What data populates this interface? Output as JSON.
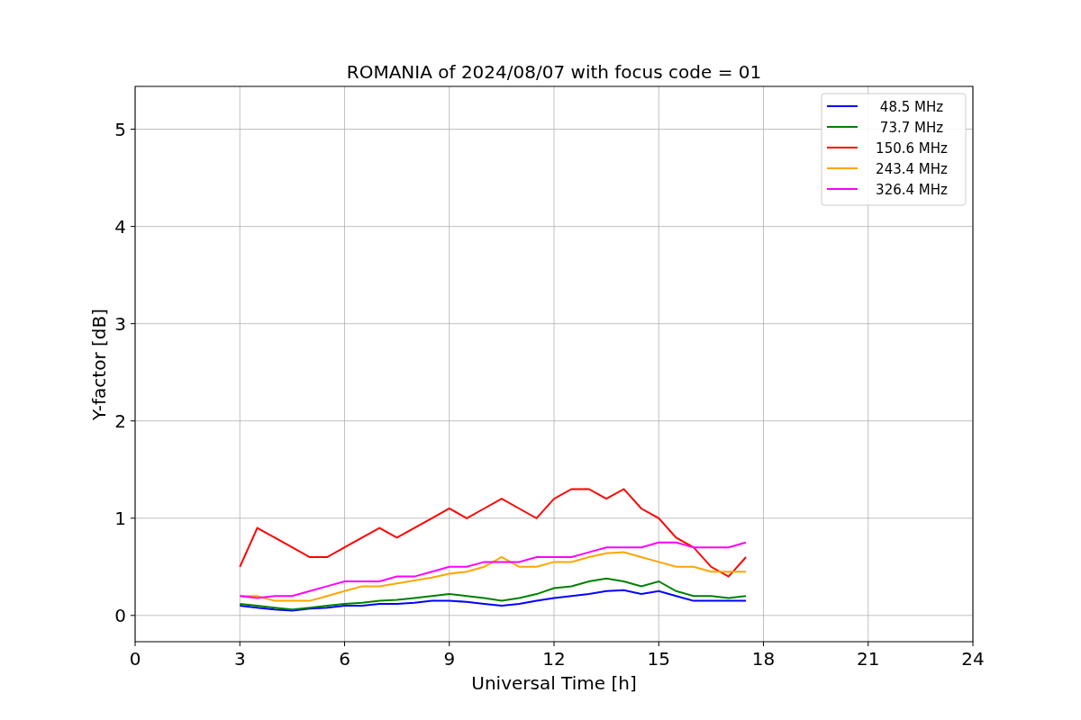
{
  "chart_data": {
    "type": "line",
    "title": "ROMANIA of 2024/08/07 with focus code = 01",
    "xlabel": "Universal Time [h]",
    "ylabel": "Y-factor [dB]",
    "x": [
      3,
      3.5,
      4,
      4.5,
      5,
      5.5,
      6,
      6.5,
      7,
      7.5,
      8,
      8.5,
      9,
      9.5,
      10,
      10.5,
      11,
      11.5,
      12,
      12.5,
      13,
      13.5,
      14,
      14.5,
      15,
      15.5,
      16,
      16.5,
      17,
      17.5
    ],
    "xlim": [
      0,
      24
    ],
    "ylim": [
      -0.27,
      5.44
    ],
    "xticks": [
      0,
      3,
      6,
      9,
      12,
      15,
      18,
      21,
      24
    ],
    "yticks": [
      0,
      1,
      2,
      3,
      4,
      5
    ],
    "grid": true,
    "legend": true,
    "series": [
      {
        "name": "48.5 MHz",
        "color": "#0000ff",
        "values": [
          0.1,
          0.08,
          0.06,
          0.05,
          0.07,
          0.08,
          0.1,
          0.1,
          0.12,
          0.12,
          0.13,
          0.15,
          0.15,
          0.14,
          0.12,
          0.1,
          0.12,
          0.15,
          0.18,
          0.2,
          0.22,
          0.25,
          0.26,
          0.22,
          0.25,
          0.2,
          0.15,
          0.15,
          0.15,
          0.15
        ]
      },
      {
        "name": "73.7 MHz",
        "color": "#008000",
        "values": [
          0.12,
          0.1,
          0.08,
          0.06,
          0.08,
          0.1,
          0.12,
          0.13,
          0.15,
          0.16,
          0.18,
          0.2,
          0.22,
          0.2,
          0.18,
          0.15,
          0.18,
          0.22,
          0.28,
          0.3,
          0.35,
          0.38,
          0.35,
          0.3,
          0.35,
          0.25,
          0.2,
          0.2,
          0.18,
          0.2
        ]
      },
      {
        "name": "150.6 MHz",
        "color": "#ff0000",
        "values": [
          0.5,
          0.9,
          0.8,
          0.7,
          0.6,
          0.6,
          0.7,
          0.8,
          0.9,
          0.8,
          0.9,
          1.0,
          1.1,
          1.0,
          1.1,
          1.2,
          1.1,
          1.0,
          1.2,
          1.3,
          1.3,
          1.2,
          1.3,
          1.1,
          1.0,
          0.8,
          0.7,
          0.5,
          0.4,
          0.6
        ]
      },
      {
        "name": "243.4 MHz",
        "color": "#ffa500",
        "values": [
          0.2,
          0.2,
          0.15,
          0.15,
          0.15,
          0.2,
          0.25,
          0.3,
          0.3,
          0.33,
          0.36,
          0.39,
          0.43,
          0.45,
          0.5,
          0.6,
          0.5,
          0.5,
          0.55,
          0.55,
          0.6,
          0.64,
          0.65,
          0.6,
          0.55,
          0.5,
          0.5,
          0.45,
          0.45,
          0.45
        ]
      },
      {
        "name": "326.4 MHz",
        "color": "#ff00ff",
        "values": [
          0.2,
          0.18,
          0.2,
          0.2,
          0.25,
          0.3,
          0.35,
          0.35,
          0.35,
          0.4,
          0.4,
          0.45,
          0.5,
          0.5,
          0.55,
          0.55,
          0.55,
          0.6,
          0.6,
          0.6,
          0.65,
          0.7,
          0.7,
          0.7,
          0.75,
          0.75,
          0.7,
          0.7,
          0.7,
          0.75
        ]
      }
    ]
  }
}
